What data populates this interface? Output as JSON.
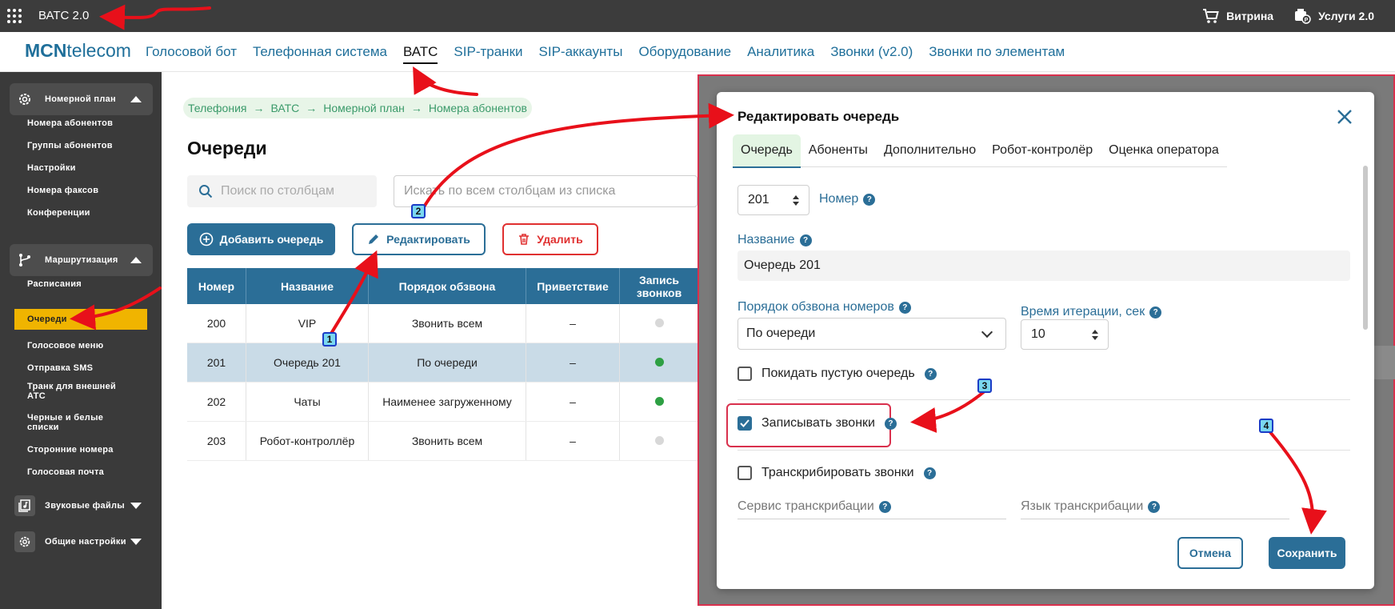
{
  "topbar": {
    "app_title": "ВАТС 2.0",
    "right_items": [
      {
        "label": "Витрина",
        "icon": "cart-icon"
      },
      {
        "label": "Услуги 2.0",
        "icon": "services-icon"
      }
    ]
  },
  "nav": {
    "brand_bold": "MCN",
    "brand_rest": "telecom",
    "items": [
      "Голосовой бот",
      "Телефонная система",
      "ВАТС",
      "SIP-транки",
      "SIP-аккаунты",
      "Оборудование",
      "Аналитика",
      "Звонки (v2.0)",
      "Звонки по элементам"
    ],
    "active": "ВАТС"
  },
  "sidebar": {
    "groups": [
      {
        "label": "Номерной план",
        "expanded": true,
        "icon": "gear-icon",
        "items": [
          "Номера абонентов",
          "Группы абонентов",
          "Настройки",
          "Номера факсов",
          "Конференции"
        ]
      },
      {
        "label": "Маршрутизация",
        "expanded": true,
        "icon": "routing-icon",
        "items": [
          "Расписания",
          "Очереди",
          "Голосовое меню",
          "Отправка SMS",
          "Транк для внешней АТС",
          "Черные и белые списки",
          "Сторонние номера",
          "Голосовая почта"
        ]
      },
      {
        "label": "Звуковые файлы",
        "expanded": false,
        "icon": "music-file-icon",
        "items": []
      },
      {
        "label": "Общие настройки",
        "expanded": false,
        "icon": "gear-icon",
        "items": []
      }
    ],
    "active_item": "Очереди"
  },
  "breadcrumb": [
    "Телефония",
    "ВАТС",
    "Номерной план",
    "Номера абонентов"
  ],
  "page": {
    "title": "Очереди",
    "search_placeholder": "Поиск по столбцам",
    "search_all_placeholder": "Искать по всем столбцам из списка",
    "btn_add": "Добавить очередь",
    "btn_edit": "Редактировать",
    "btn_delete": "Удалить"
  },
  "table": {
    "headers": [
      "Номер",
      "Название",
      "Порядок обзвона",
      "Приветствие",
      "Запись звонков"
    ],
    "rows": [
      {
        "number": "200",
        "name": "VIP",
        "order": "Звонить всем",
        "greeting": "–",
        "record": false,
        "selected": false
      },
      {
        "number": "201",
        "name": "Очередь 201",
        "order": "По очереди",
        "greeting": "–",
        "record": true,
        "selected": true
      },
      {
        "number": "202",
        "name": "Чаты",
        "order": "Наименее загруженному",
        "greeting": "–",
        "record": true,
        "selected": false
      },
      {
        "number": "203",
        "name": "Робот-контроллёр",
        "order": "Звонить всем",
        "greeting": "–",
        "record": false,
        "selected": false
      }
    ]
  },
  "modal": {
    "title": "Редактировать очередь",
    "tabs": [
      "Очередь",
      "Абоненты",
      "Дополнительно",
      "Робот-контролёр",
      "Оценка оператора"
    ],
    "active_tab": "Очередь",
    "number_value": "201",
    "number_label": "Номер",
    "name_label": "Название",
    "name_value": "Очередь 201",
    "order_label": "Порядок обзвона номеров",
    "order_value": "По очереди",
    "iteration_label": "Время итерации, сек",
    "iteration_value": "10",
    "leave_empty_label": "Покидать пустую очередь",
    "leave_empty_checked": false,
    "record_label": "Записывать звонки",
    "record_checked": true,
    "transcribe_label": "Транскрибировать звонки",
    "transcribe_checked": false,
    "service_label": "Сервис транскрибации",
    "language_label": "Язык транскрибации",
    "btn_cancel": "Отмена",
    "btn_save": "Сохранить"
  },
  "annotations": {
    "badges": [
      "1",
      "2",
      "3",
      "4"
    ],
    "arrow_color": "#e8101a",
    "badge_color": "#7ad7f0"
  },
  "colors": {
    "accent": "#2b6e97",
    "danger": "#e03030",
    "sidebar": "#3a3a3a",
    "sidebar_active": "#f0b400",
    "record_on": "#2ea043",
    "record_off": "#d8d8d8"
  }
}
